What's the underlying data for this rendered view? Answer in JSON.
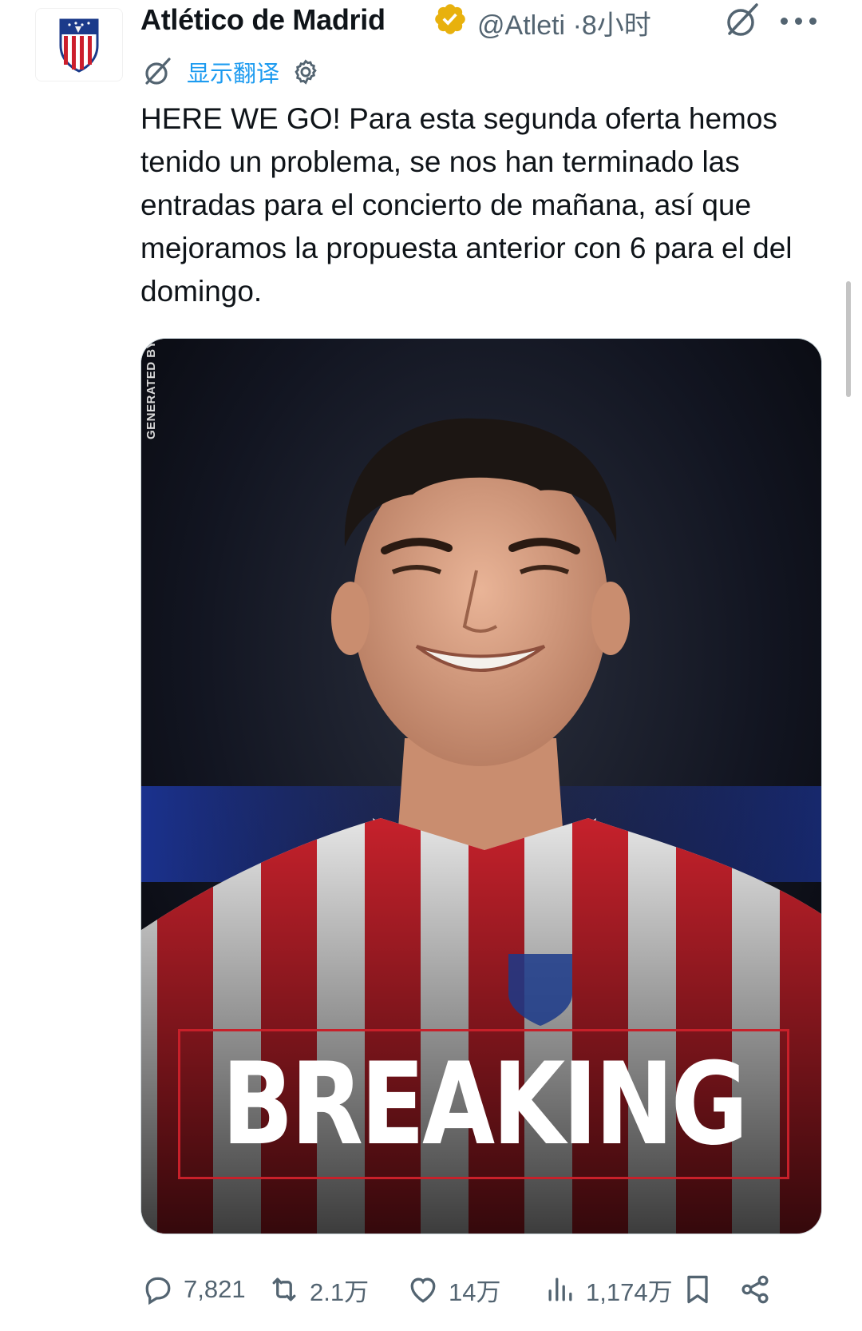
{
  "account": {
    "name": "Atlético de Madrid",
    "handle": "@Atleti",
    "separator": "·",
    "time": "8小时",
    "avatar_icon": "atletico-crest-icon",
    "verified_color": "#e8b10d"
  },
  "translate": {
    "label": "显示翻译",
    "icon": "grok-icon",
    "settings_icon": "gear-icon"
  },
  "tweet": {
    "text": "HERE WE GO! Para esta segunda oferta hemos tenido un problema, se nos han terminado las entradas para el concierto de mañana, así que mejoramos la propuesta anterior con 6 para el del domingo."
  },
  "media": {
    "side_label": "GENERATED BY AI",
    "headline": "BREAKING",
    "frame_color": "#c8202a"
  },
  "actions": {
    "replies": "7,821",
    "reposts": "2.1万",
    "likes": "14万",
    "views": "1,174万"
  },
  "colors": {
    "accent": "#1d9bf0",
    "muted": "#536471",
    "text": "#0f1419"
  }
}
